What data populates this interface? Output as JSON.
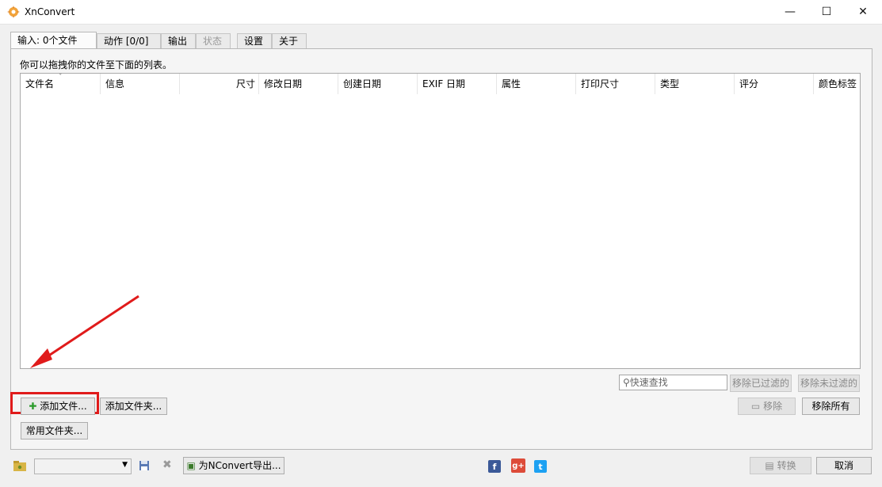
{
  "window": {
    "title": "XnConvert",
    "controls": {
      "minimize": "—",
      "maximize": "☐",
      "close": "✕"
    }
  },
  "tabs": [
    {
      "label": "输入: 0个文件"
    },
    {
      "label": "动作 [0/0]"
    },
    {
      "label": "输出"
    },
    {
      "label": "状态"
    },
    {
      "label": "设置"
    },
    {
      "label": "关于"
    }
  ],
  "input": {
    "hint": "你可以拖拽你的文件至下面的列表。",
    "columns": [
      "文件名",
      "信息",
      "尺寸",
      "修改日期",
      "创建日期",
      "EXIF 日期",
      "属性",
      "打印尺寸",
      "类型",
      "评分",
      "颜色标签"
    ],
    "search_placeholder": "快速查找",
    "buttons": {
      "remove_filtered": "移除已过滤的",
      "remove_unfiltered": "移除未过滤的",
      "add_files": "添加文件...",
      "add_folder": "添加文件夹...",
      "common_folder": "常用文件夹...",
      "remove": "移除",
      "remove_all": "移除所有"
    }
  },
  "bottom": {
    "export_button": "为NConvert导出...",
    "convert_button": "转换",
    "cancel_button": "取消",
    "social": {
      "facebook": "f",
      "googleplus": "g+",
      "twitter": "t"
    }
  },
  "colors": {
    "highlight": "#e01b1b",
    "arrow": "#e01b1b",
    "facebook": "#3b5998",
    "googleplus": "#dd4b39",
    "twitter": "#1da1f2"
  }
}
